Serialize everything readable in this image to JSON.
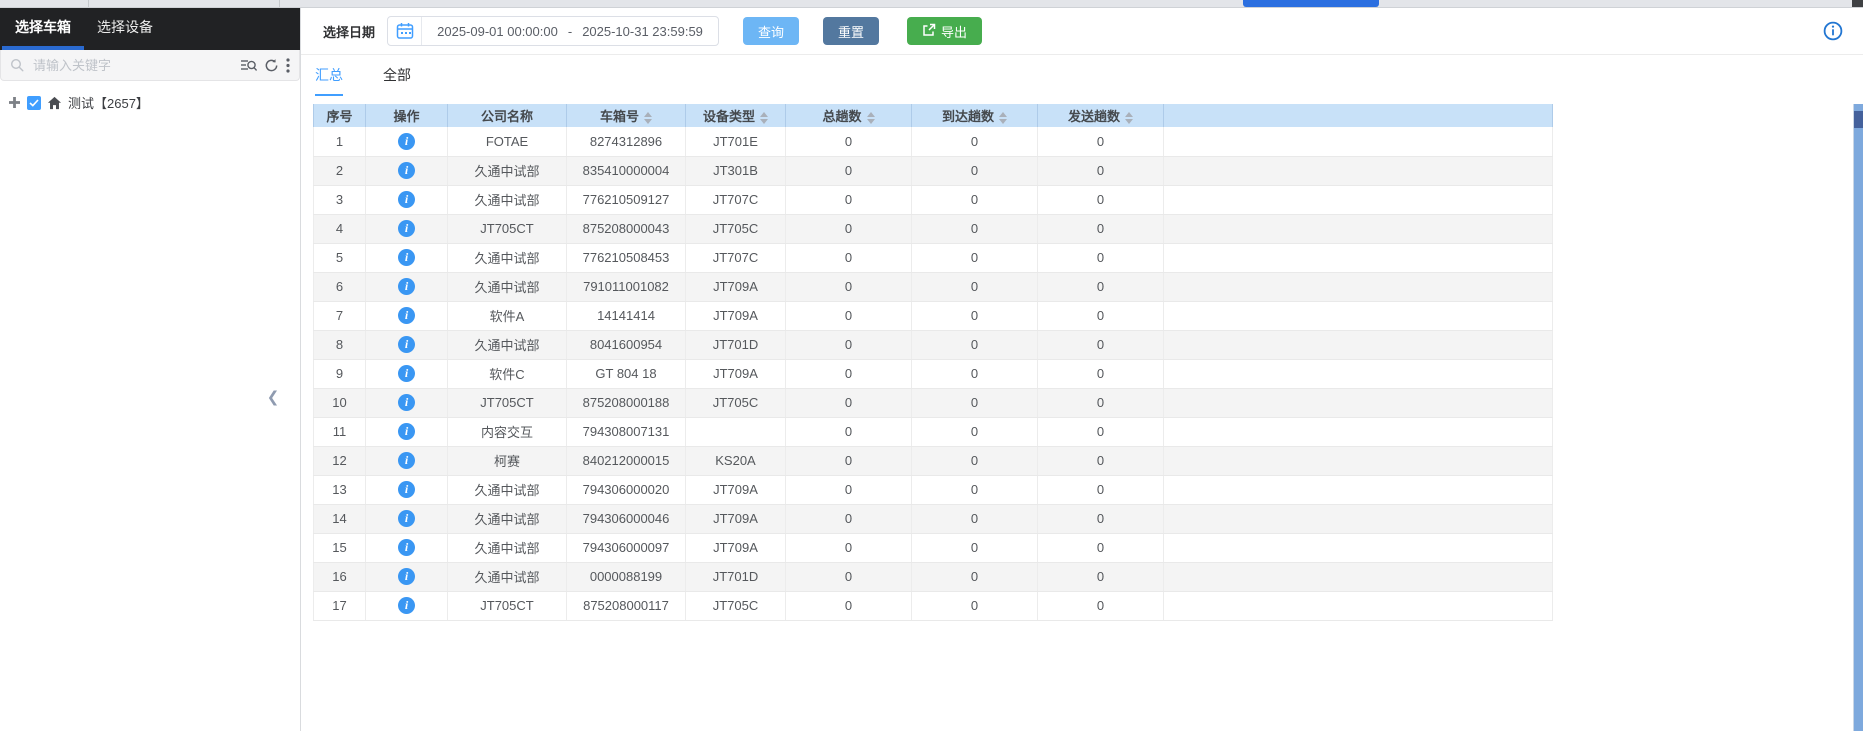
{
  "colors": {
    "accent_blue": "#409eff",
    "sidebar_header_bg": "#212224",
    "sidebar_active_underline": "#2a6ad0",
    "query_button_bg": "#6db6f5",
    "reset_button_bg": "#53789f",
    "export_button_bg": "#47ad4e",
    "table_header_bg": "#c8e1f8",
    "row_alt_bg": "#f4f4f4",
    "info_icon_bg": "#3a97f3",
    "scrollbar_color": "#7ea9dd"
  },
  "sidebar": {
    "tabs": [
      {
        "label": "选择车箱",
        "active": true
      },
      {
        "label": "选择设备",
        "active": false
      }
    ],
    "search": {
      "placeholder": "请输入关键字",
      "icons": [
        "search-icon",
        "advanced-search-icon",
        "refresh-icon",
        "more-vertical-icon"
      ]
    },
    "tree": [
      {
        "label": "测试【2657】",
        "checked": true,
        "expander": "plus-icon",
        "icon": "home-icon"
      }
    ],
    "collapse_icon": "chevron-left-icon"
  },
  "toolbar": {
    "date_label": "选择日期",
    "calendar_icon": "calendar-icon",
    "date_start": "2025-09-01 00:00:00",
    "date_separator": "-",
    "date_end": "2025-10-31 23:59:59",
    "query_label": "查询",
    "reset_label": "重置",
    "export_label": "导出",
    "export_icon": "export-icon",
    "info_icon": "info-circle-icon"
  },
  "main_tabs": [
    {
      "label": "汇总",
      "active": true
    },
    {
      "label": "全部",
      "active": false
    }
  ],
  "table": {
    "columns": [
      {
        "label": "序号",
        "sortable": false
      },
      {
        "label": "操作",
        "sortable": false
      },
      {
        "label": "公司名称",
        "sortable": false
      },
      {
        "label": "车箱号",
        "sortable": true
      },
      {
        "label": "设备类型",
        "sortable": true
      },
      {
        "label": "总趟数",
        "sortable": true
      },
      {
        "label": "到达趟数",
        "sortable": true
      },
      {
        "label": "发送趟数",
        "sortable": true
      }
    ],
    "rows": [
      {
        "index": 1,
        "company": "FOTAE",
        "box_no": "8274312896",
        "device_type": "JT701E",
        "total": 0,
        "arrived": 0,
        "sent": 0
      },
      {
        "index": 2,
        "company": "久通中试部",
        "box_no": "835410000004",
        "device_type": "JT301B",
        "total": 0,
        "arrived": 0,
        "sent": 0
      },
      {
        "index": 3,
        "company": "久通中试部",
        "box_no": "776210509127",
        "device_type": "JT707C",
        "total": 0,
        "arrived": 0,
        "sent": 0
      },
      {
        "index": 4,
        "company": "JT705CT",
        "box_no": "875208000043",
        "device_type": "JT705C",
        "total": 0,
        "arrived": 0,
        "sent": 0
      },
      {
        "index": 5,
        "company": "久通中试部",
        "box_no": "776210508453",
        "device_type": "JT707C",
        "total": 0,
        "arrived": 0,
        "sent": 0
      },
      {
        "index": 6,
        "company": "久通中试部",
        "box_no": "791011001082",
        "device_type": "JT709A",
        "total": 0,
        "arrived": 0,
        "sent": 0
      },
      {
        "index": 7,
        "company": "软件A",
        "box_no": "14141414",
        "device_type": "JT709A",
        "total": 0,
        "arrived": 0,
        "sent": 0
      },
      {
        "index": 8,
        "company": "久通中试部",
        "box_no": "8041600954",
        "device_type": "JT701D",
        "total": 0,
        "arrived": 0,
        "sent": 0
      },
      {
        "index": 9,
        "company": "软件C",
        "box_no": "GT 804 18",
        "device_type": "JT709A",
        "total": 0,
        "arrived": 0,
        "sent": 0
      },
      {
        "index": 10,
        "company": "JT705CT",
        "box_no": "875208000188",
        "device_type": "JT705C",
        "total": 0,
        "arrived": 0,
        "sent": 0
      },
      {
        "index": 11,
        "company": "内容交互",
        "box_no": "794308007131",
        "device_type": "",
        "total": 0,
        "arrived": 0,
        "sent": 0
      },
      {
        "index": 12,
        "company": "柯赛",
        "box_no": "840212000015",
        "device_type": "KS20A",
        "total": 0,
        "arrived": 0,
        "sent": 0
      },
      {
        "index": 13,
        "company": "久通中试部",
        "box_no": "794306000020",
        "device_type": "JT709A",
        "total": 0,
        "arrived": 0,
        "sent": 0
      },
      {
        "index": 14,
        "company": "久通中试部",
        "box_no": "794306000046",
        "device_type": "JT709A",
        "total": 0,
        "arrived": 0,
        "sent": 0
      },
      {
        "index": 15,
        "company": "久通中试部",
        "box_no": "794306000097",
        "device_type": "JT709A",
        "total": 0,
        "arrived": 0,
        "sent": 0
      },
      {
        "index": 16,
        "company": "久通中试部",
        "box_no": "0000088199",
        "device_type": "JT701D",
        "total": 0,
        "arrived": 0,
        "sent": 0
      },
      {
        "index": 17,
        "company": "JT705CT",
        "box_no": "875208000117",
        "device_type": "JT705C",
        "total": 0,
        "arrived": 0,
        "sent": 0
      }
    ]
  }
}
